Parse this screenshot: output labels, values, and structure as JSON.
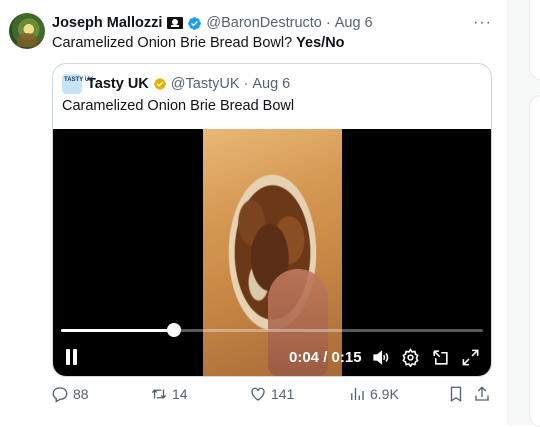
{
  "tweet": {
    "author_name": "Joseph Mallozzi",
    "author_handle": "@BaronDestructo",
    "date": "Aug 6",
    "separator": "·",
    "text": "Caramelized Onion Brie Bread Bowl?",
    "text_bold": "Yes/No",
    "more_label": "···"
  },
  "quote": {
    "author_name": "Tasty UK",
    "author_handle": "@TastyUK",
    "date": "Aug 6",
    "separator": "·",
    "avatar_text": "TASTY UK",
    "text": "Caramelized Onion Brie Bread Bowl"
  },
  "video": {
    "current_time": "0:04",
    "duration": "0:15",
    "time_display": "0:04 / 0:15",
    "progress_fraction": 0.267
  },
  "actions": {
    "replies": "88",
    "retweets": "14",
    "likes": "141",
    "views": "6.9K"
  },
  "colors": {
    "verified_blue": "#1d9bf0",
    "verified_gold": "#e8b100",
    "muted_text": "#536471",
    "border": "#cfd9de"
  },
  "icons": [
    "flag-icon",
    "verified-badge-icon",
    "more-icon",
    "pause-icon",
    "volume-icon",
    "settings-icon",
    "pip-icon",
    "fullscreen-icon",
    "reply-icon",
    "retweet-icon",
    "like-icon",
    "views-icon",
    "bookmark-icon",
    "share-icon"
  ]
}
